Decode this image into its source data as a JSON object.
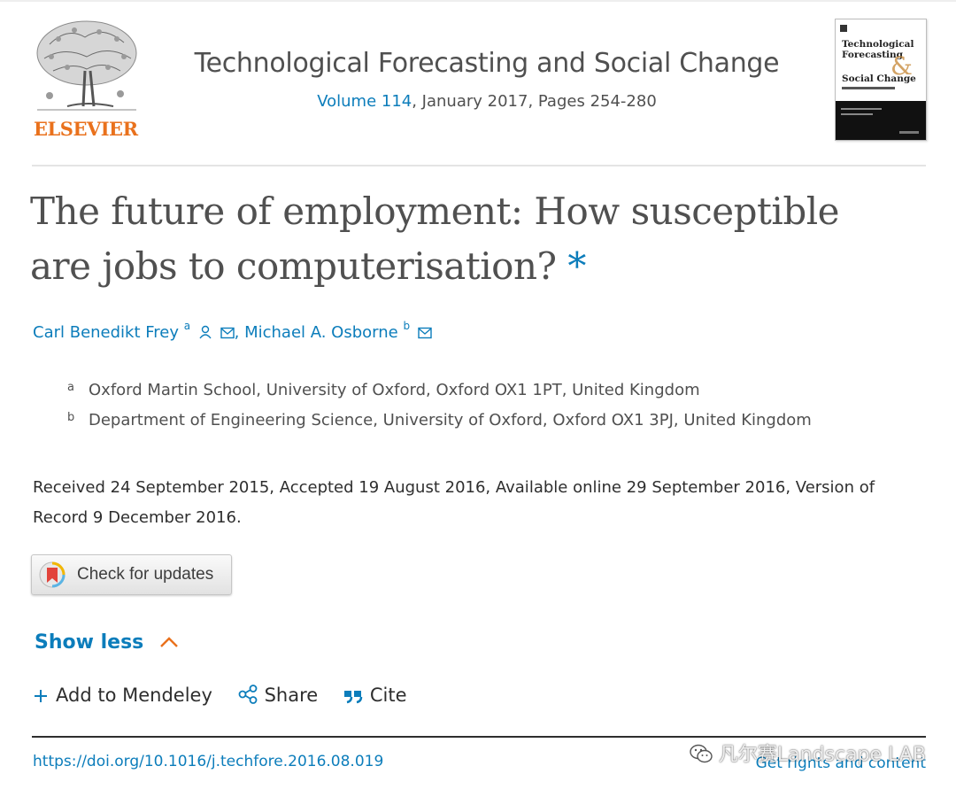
{
  "publisher": {
    "name": "ELSEVIER"
  },
  "journal": {
    "title": "Technological Forecasting and Social Change",
    "volume_label": "Volume 114",
    "issue_info": ", January 2017, Pages 254-280",
    "cover": {
      "line1": "Technological",
      "line2": "Forecasting",
      "line3": "Social Change"
    }
  },
  "article": {
    "title": "The future of employment: How susceptible are jobs to computerisation?",
    "title_marker": "*"
  },
  "authors": [
    {
      "name": "Carl Benedikt Frey",
      "sup": "a",
      "icons": [
        "person-icon",
        "email-icon"
      ]
    },
    {
      "name": "Michael A. Osborne",
      "sup": "b",
      "icons": [
        "email-icon"
      ]
    }
  ],
  "author_separator": ",",
  "affiliations": [
    {
      "mark": "a",
      "text": "Oxford Martin School, University of Oxford, Oxford OX1 1PT, United Kingdom"
    },
    {
      "mark": "b",
      "text": "Department of Engineering Science, University of Oxford, Oxford OX1 3PJ, United Kingdom"
    }
  ],
  "dates": "Received 24 September 2015, Accepted 19 August 2016, Available online 29 September 2016, Version of Record 9 December 2016.",
  "check_updates": {
    "label": "Check for updates"
  },
  "show_less": {
    "label": "Show less"
  },
  "actions": {
    "mendeley": "Add to Mendeley",
    "share": "Share",
    "cite": "Cite"
  },
  "footer": {
    "doi": "https://doi.org/10.1016/j.techfore.2016.08.019",
    "rights": "Get rights and content"
  },
  "watermark": {
    "text": "凡尔赛Landscape LAB"
  },
  "colors": {
    "link": "#0c7dbb",
    "publisher": "#e9711c",
    "text": "#505050"
  }
}
